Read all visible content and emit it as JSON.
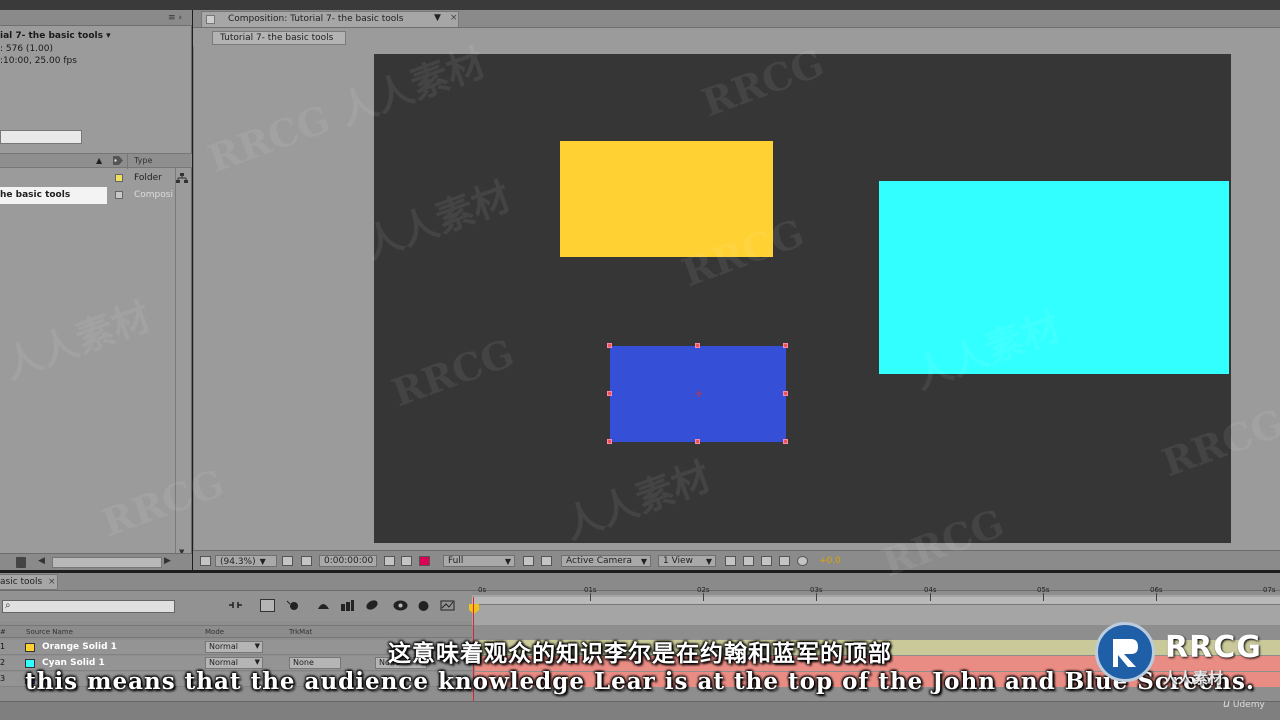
{
  "project": {
    "comp_name": "ial 7- the basic tools ▾",
    "comp_size": ": 576 (1.00)",
    "comp_duration": ":10:00, 25.00 fps",
    "column_type": "Type",
    "items": [
      {
        "name": "",
        "type": "Folder",
        "swatch": "#f0e060"
      },
      {
        "name": "he basic tools",
        "type": "Composi",
        "swatch": "#c8c8c8"
      }
    ]
  },
  "composition": {
    "tab_label": "Composition: Tutorial 7- the basic tools",
    "breadcrumb": "Tutorial 7- the basic tools",
    "layers_on_canvas": [
      {
        "name": "orange",
        "color": "#ffd133"
      },
      {
        "name": "cyan",
        "color": "#32ffff"
      },
      {
        "name": "blue",
        "color": "#3550d6",
        "selected": true
      }
    ],
    "toolbar": {
      "magnification": "(94.3%)",
      "timecode": "0:00:00:00",
      "resolution": "Full",
      "camera": "Active Camera",
      "views": "1 View",
      "exposure": "+0.0"
    }
  },
  "timeline": {
    "tab_label": "asic tools",
    "columns": {
      "source_name": "Source Name",
      "mode": "Mode",
      "trkmat": "TrkMat"
    },
    "time_ticks": [
      "0s",
      "01s",
      "02s",
      "03s",
      "04s",
      "05s",
      "06s",
      "07s"
    ],
    "layers": [
      {
        "num": "1",
        "name": "Orange Solid 1",
        "color": "#ffd133",
        "mode": "Normal",
        "trkmat": "",
        "parent": ""
      },
      {
        "num": "2",
        "name": "Cyan Solid 1",
        "color": "#32ffff",
        "mode": "Normal",
        "trkmat": "None",
        "parent": "None"
      },
      {
        "num": "3",
        "name": "",
        "color": "#3550d6",
        "mode": "",
        "trkmat": "",
        "parent": ""
      }
    ]
  },
  "subtitles": {
    "chinese": "这意味着观众的知识李尔是在约翰和蓝军的顶部",
    "english": "this means that the audience knowledge Lear is at the top of the John and Blue Screens."
  },
  "branding": {
    "logo_text": "RRCG",
    "logo_sub": "人人素材",
    "udemy": "Udemy",
    "watermark": "RRCG 人人素材"
  }
}
